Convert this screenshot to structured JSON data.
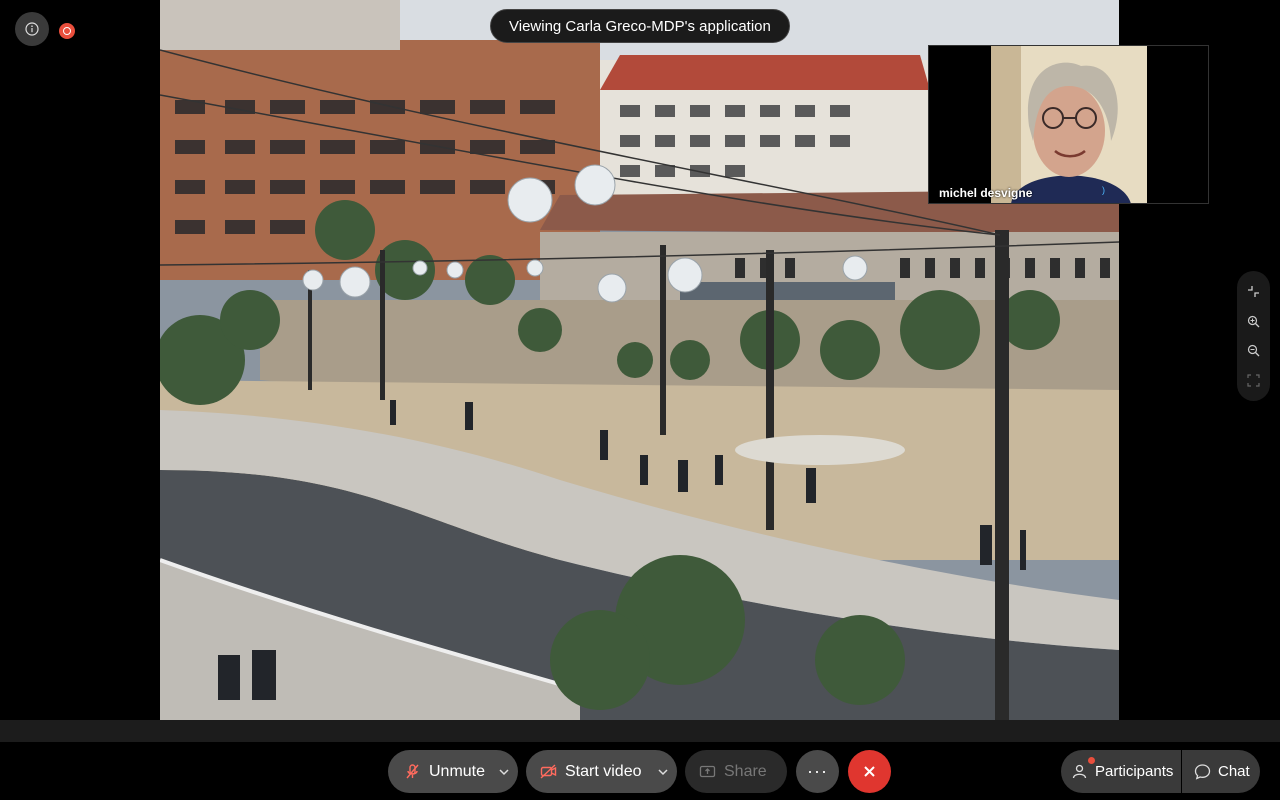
{
  "meeting": {
    "viewing_banner": "Viewing Carla Greco-MDP's application",
    "info_icon": "info-icon",
    "recording_icon": "recording-indicator-icon"
  },
  "shared_content": {
    "description_icon": "shared-screen-photo"
  },
  "participant_video": {
    "name": "michel desvigne"
  },
  "zoom_toolbar": {
    "items": [
      "exit-fullscreen-icon",
      "zoom-in-icon",
      "zoom-out-icon",
      "fit-screen-icon"
    ]
  },
  "controls": {
    "unmute_label": "Unmute",
    "start_video_label": "Start video",
    "share_label": "Share",
    "more_label": "···",
    "participants_label": "Participants",
    "chat_label": "Chat"
  },
  "colors": {
    "leave": "#e0362f",
    "recording": "#e94e3c",
    "control_bg": "#4a4a4a"
  }
}
